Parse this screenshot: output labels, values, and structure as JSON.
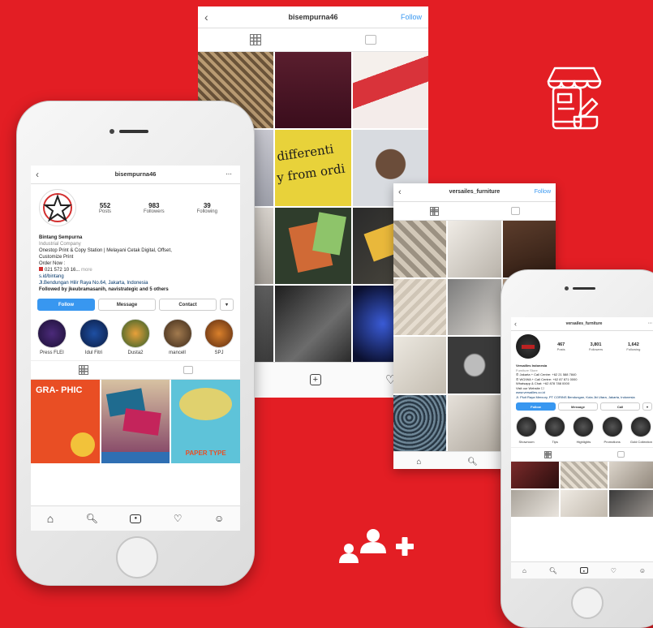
{
  "colors": {
    "background": "#e31e24",
    "accent": "#3897f0"
  },
  "center_screen": {
    "username": "bisempurna46",
    "follow_label": "Follow",
    "overlay_texts": [
      "differenti",
      "y from ordi"
    ]
  },
  "mid_screen": {
    "username": "versailes_furniture",
    "follow_label": "Follow"
  },
  "left_phone": {
    "username": "bisempurna46",
    "stats": [
      {
        "value": "552",
        "label": "Posts"
      },
      {
        "value": "983",
        "label": "Followers"
      },
      {
        "value": "39",
        "label": "Following"
      }
    ],
    "bio": {
      "name": "Bintang Sempurna",
      "category": "Industrial Company",
      "desc1": "Onestop Print & Copy Station | Melayani Cetak Digital, Offset,",
      "desc2": "Customize Print",
      "order": "Order Now :",
      "phone": "021 572 10 16...",
      "more": "more",
      "link": "s.id/bintang",
      "address": "Jl.Bendungan Hilir Raya No.64, Jakarta, Indonesia",
      "followed": "Followed by jkeubramasanih, navistrategic and 5 others"
    },
    "buttons": {
      "follow": "Follow",
      "message": "Message",
      "contact": "Contact"
    },
    "highlights": [
      "Press FLEI",
      "Idul Fitri",
      "Dusta2",
      "mancell",
      "SPJ"
    ],
    "posts": [
      {
        "text": "GRA- PHIC"
      },
      {
        "text": ""
      },
      {
        "text": "PAPER TYPE"
      }
    ]
  },
  "right_phone": {
    "username": "versailes_furniture",
    "stats": [
      {
        "value": "467",
        "label": "Posts"
      },
      {
        "value": "3,801",
        "label": "Followers"
      },
      {
        "value": "1,642",
        "label": "Following"
      }
    ],
    "bio": {
      "name": "Versailles Indonesia",
      "category": "Furniture Store",
      "line1": "✆ Jakarta + Call Centre: +62 21 588 7840",
      "line2": "✆ WO/WA + Call Centre: +62 87 871 0000",
      "line3": "Whatsapp & Chat: +62 878 788 0000",
      "line4": "Visit our Website ☐",
      "link": "www.versailles.co.id",
      "address": "Jl. Pluit Raya Mercury, PT CORINS Bendungan, Kota Jkt Utara, Jakarta, Indonesia"
    },
    "buttons": {
      "follow": "Follow",
      "message": "Message",
      "call": "Call"
    },
    "highlights": [
      "Showroom",
      "Tips",
      "Highlights",
      "Promotions",
      "Gold Collection"
    ]
  },
  "icons": {
    "store_icon": "storefront-with-phone-icon",
    "add_user_icon": "add-users-icon"
  }
}
